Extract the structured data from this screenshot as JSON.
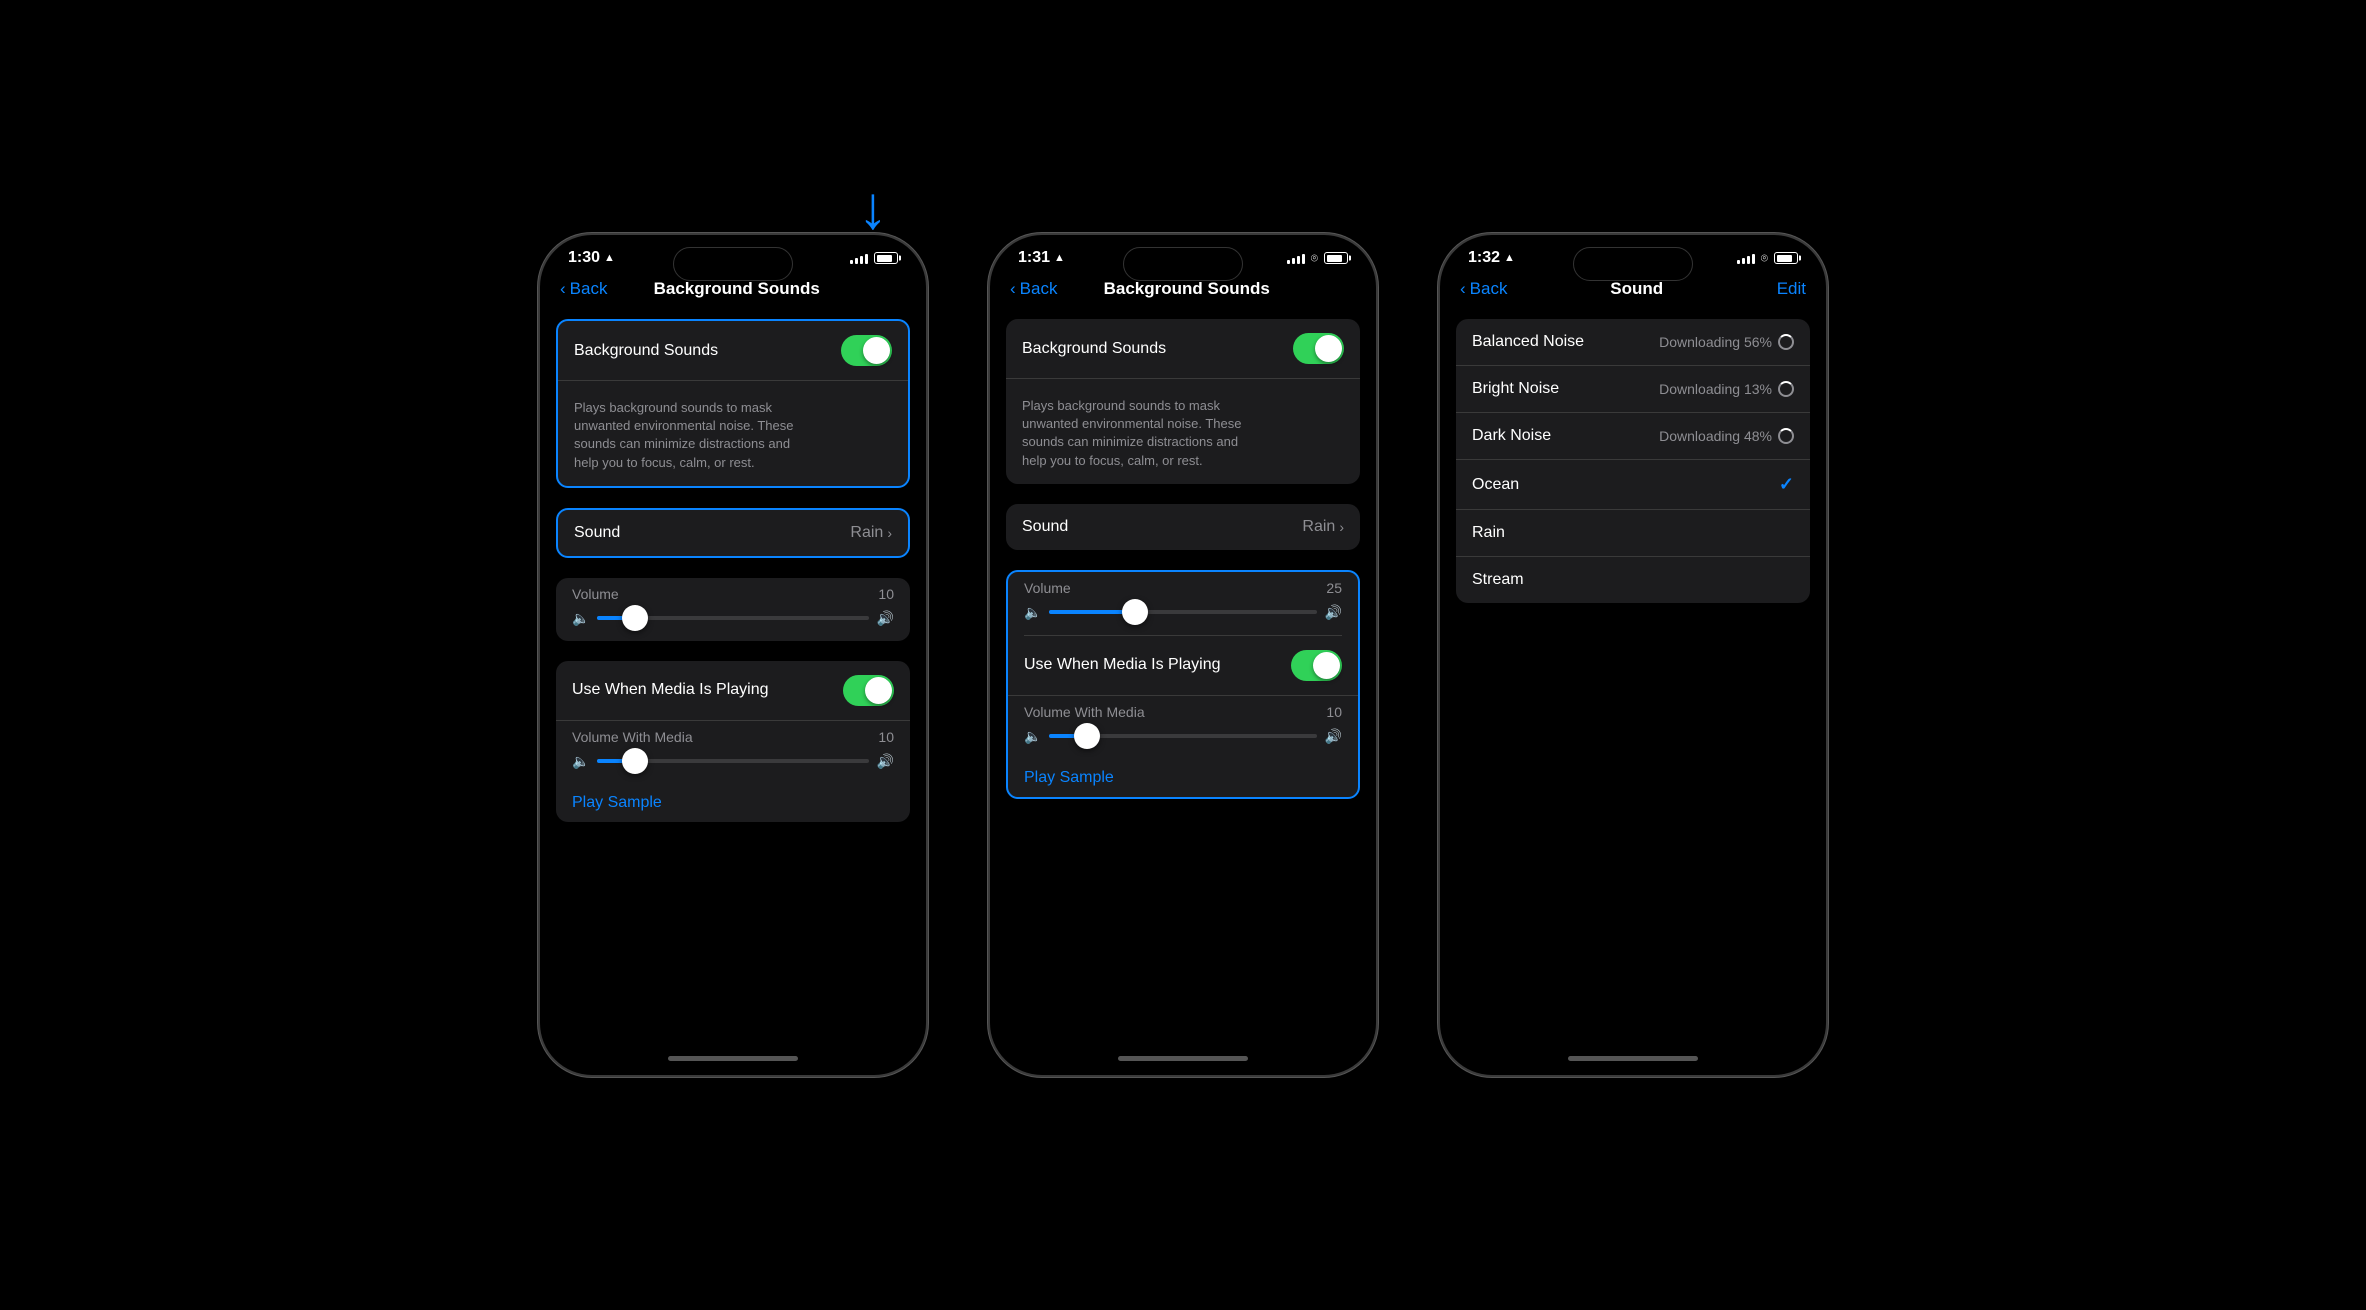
{
  "phone1": {
    "status": {
      "time": "1:30",
      "location": true
    },
    "nav": {
      "back": "Back",
      "title": "Background Sounds",
      "action": ""
    },
    "background_sounds_toggle": {
      "label": "Background Sounds",
      "description": "Plays background sounds to mask unwanted environmental noise. These sounds can minimize distractions and help you to focus, calm, or rest.",
      "state": "on"
    },
    "sound_row": {
      "label": "Sound",
      "value": "Rain"
    },
    "volume": {
      "label": "Volume",
      "value": "10",
      "fill_percent": 14
    },
    "use_when_media": {
      "label": "Use When Media Is Playing",
      "state": "on"
    },
    "volume_with_media": {
      "label": "Volume With Media",
      "value": "10",
      "fill_percent": 14
    },
    "play_sample": "Play Sample",
    "highlight_section1": true,
    "highlight_section2": true,
    "has_arrow": true
  },
  "phone2": {
    "status": {
      "time": "1:31",
      "location": true
    },
    "nav": {
      "back": "Back",
      "title": "Background Sounds",
      "action": ""
    },
    "background_sounds_toggle": {
      "label": "Background Sounds",
      "description": "Plays background sounds to mask unwanted environmental noise. These sounds can minimize distractions and help you to focus, calm, or rest.",
      "state": "on"
    },
    "sound_row": {
      "label": "Sound",
      "value": "Rain"
    },
    "volume": {
      "label": "Volume",
      "value": "25",
      "fill_percent": 32
    },
    "use_when_media": {
      "label": "Use When Media Is Playing",
      "state": "on"
    },
    "volume_with_media": {
      "label": "Volume With Media",
      "value": "10",
      "fill_percent": 14
    },
    "play_sample": "Play Sample",
    "highlight_volume_section": true
  },
  "phone3": {
    "status": {
      "time": "1:32",
      "location": true
    },
    "nav": {
      "back": "Back",
      "title": "Sound",
      "action": "Edit"
    },
    "sounds": [
      {
        "name": "Balanced Noise",
        "status": "Downloading 56%",
        "type": "downloading"
      },
      {
        "name": "Bright Noise",
        "status": "Downloading 13%",
        "type": "downloading"
      },
      {
        "name": "Dark Noise",
        "status": "Downloading 48%",
        "type": "downloading"
      },
      {
        "name": "Ocean",
        "status": "selected",
        "type": "selected"
      },
      {
        "name": "Rain",
        "status": "",
        "type": "normal"
      },
      {
        "name": "Stream",
        "status": "",
        "type": "normal"
      }
    ]
  }
}
